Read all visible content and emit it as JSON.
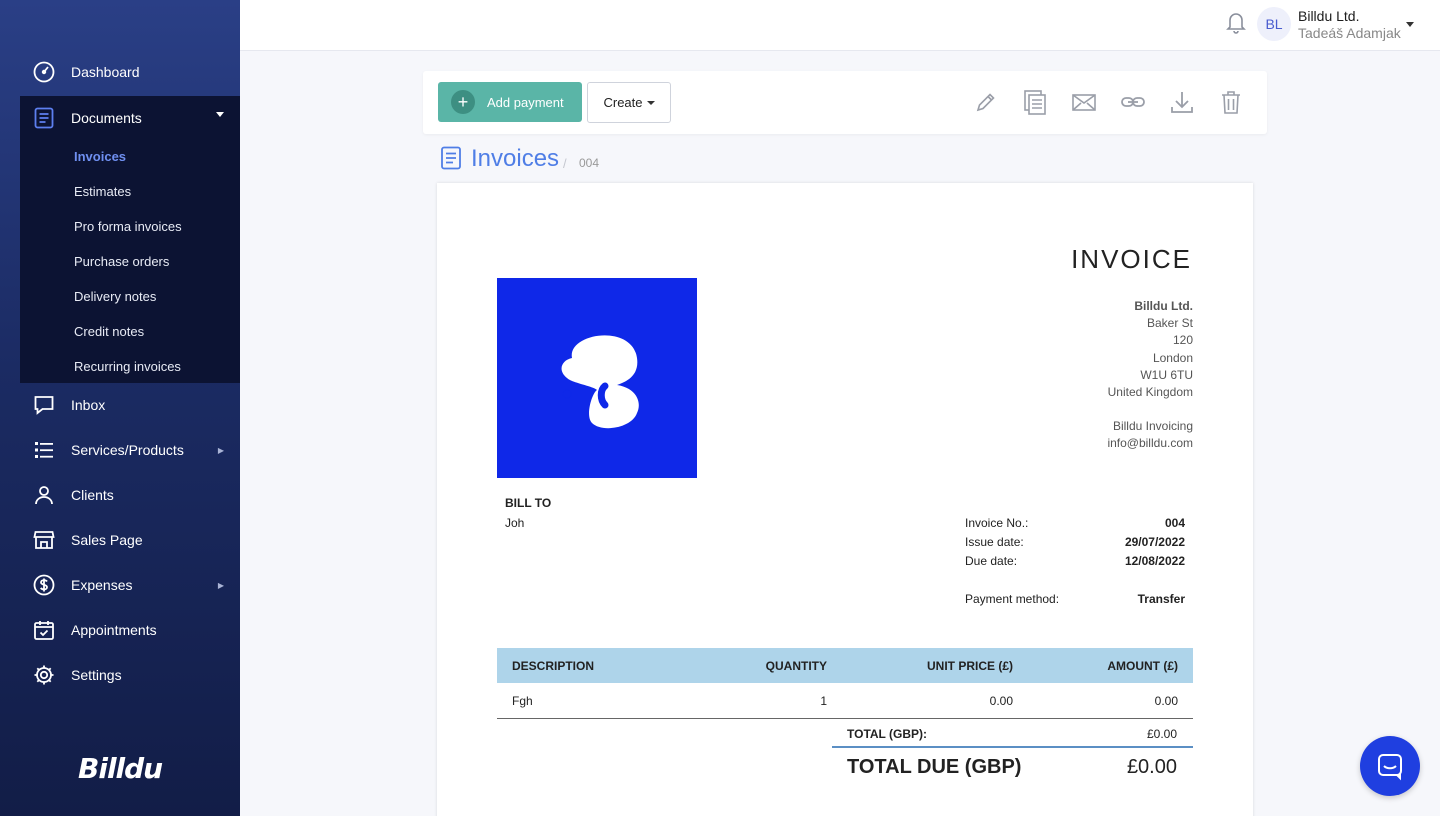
{
  "sidebar": {
    "items": [
      {
        "label": "Dashboard",
        "icon": "gauge-icon"
      },
      {
        "label": "Documents",
        "icon": "document-icon"
      },
      {
        "label": "Inbox",
        "icon": "chat-bubble-icon"
      },
      {
        "label": "Services/Products",
        "icon": "list-icon"
      },
      {
        "label": "Clients",
        "icon": "person-icon"
      },
      {
        "label": "Sales Page",
        "icon": "storefront-icon"
      },
      {
        "label": "Expenses",
        "icon": "dollar-circle-icon"
      },
      {
        "label": "Appointments",
        "icon": "calendar-check-icon"
      },
      {
        "label": "Settings",
        "icon": "gear-icon"
      }
    ],
    "documents_sub": [
      {
        "label": "Invoices",
        "active": true
      },
      {
        "label": "Estimates"
      },
      {
        "label": "Pro forma invoices"
      },
      {
        "label": "Purchase orders"
      },
      {
        "label": "Delivery notes"
      },
      {
        "label": "Credit notes"
      },
      {
        "label": "Recurring invoices"
      }
    ],
    "brand": "Billdu"
  },
  "header": {
    "avatar_initials": "BL",
    "company": "Billdu Ltd.",
    "user": "Tadeáš Adamjak"
  },
  "toolbar": {
    "add_payment_label": "Add payment",
    "create_label": "Create",
    "icons": [
      "pencil-icon",
      "copy-icon",
      "envelope-icon",
      "link-icon",
      "download-icon",
      "trash-icon"
    ]
  },
  "breadcrumb": {
    "title": "Invoices",
    "separator": "/",
    "number": "004"
  },
  "invoice": {
    "title": "INVOICE",
    "seller": {
      "name": "Billdu Ltd.",
      "street": "Baker St",
      "number": "120",
      "city": "London",
      "postcode": "W1U 6TU",
      "country": "United Kingdom",
      "contact_name": "Billdu Invoicing",
      "email": "info@billdu.com"
    },
    "bill_to_label": "BILL TO",
    "bill_to": "Joh",
    "meta": {
      "invoice_no_label": "Invoice No.:",
      "invoice_no": "004",
      "issue_date_label": "Issue date:",
      "issue_date": "29/07/2022",
      "due_date_label": "Due date:",
      "due_date": "12/08/2022",
      "payment_method_label": "Payment method:",
      "payment_method": "Transfer"
    },
    "table": {
      "headers": [
        "DESCRIPTION",
        "QUANTITY",
        "UNIT PRICE (£)",
        "AMOUNT (£)"
      ],
      "rows": [
        {
          "description": "Fgh",
          "quantity": "1",
          "unit_price": "0.00",
          "amount": "0.00"
        }
      ]
    },
    "total_label": "TOTAL (GBP):",
    "total_value": "£0.00",
    "total_due_label": "TOTAL DUE (GBP)",
    "total_due_value": "£0.00"
  },
  "colors": {
    "accent": "#5ab5a7",
    "link": "#4f7ee6",
    "logo_bg": "#0f28e8",
    "table_header": "#aed4ea",
    "chat": "#1f3fe0"
  }
}
